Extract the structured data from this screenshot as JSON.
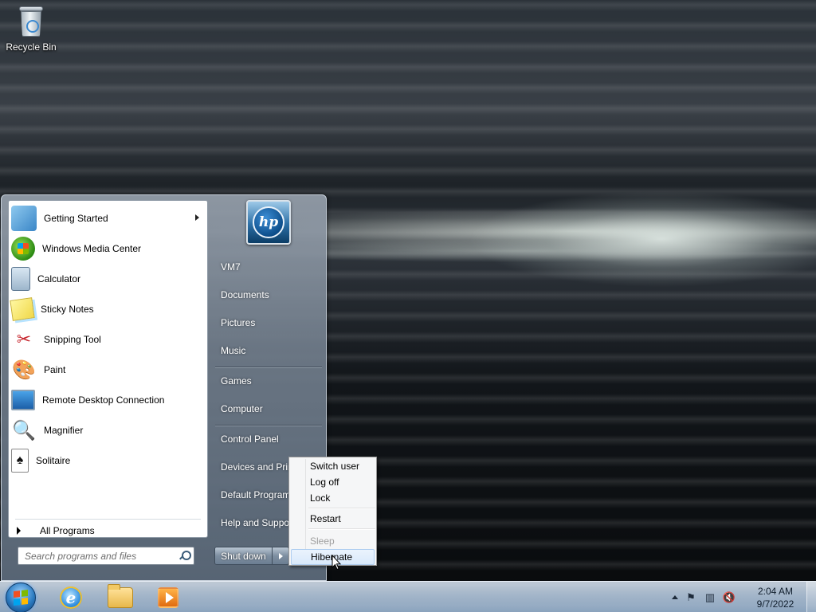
{
  "desktop": {
    "icons": [
      {
        "label": "Recycle Bin",
        "icon": "recycle-bin-icon"
      }
    ]
  },
  "start_menu": {
    "programs": [
      {
        "label": "Getting Started",
        "icon": "getting-started-icon",
        "has_submenu": true
      },
      {
        "label": "Windows Media Center",
        "icon": "windows-media-center-icon"
      },
      {
        "label": "Calculator",
        "icon": "calculator-icon"
      },
      {
        "label": "Sticky Notes",
        "icon": "sticky-notes-icon"
      },
      {
        "label": "Snipping Tool",
        "icon": "snipping-tool-icon"
      },
      {
        "label": "Paint",
        "icon": "paint-icon"
      },
      {
        "label": "Remote Desktop Connection",
        "icon": "remote-desktop-icon"
      },
      {
        "label": "Magnifier",
        "icon": "magnifier-icon"
      },
      {
        "label": "Solitaire",
        "icon": "solitaire-icon"
      }
    ],
    "all_programs_label": "All Programs",
    "search_placeholder": "Search programs and files",
    "user_picture_text": "hp",
    "right_items": [
      "VM7",
      "Documents",
      "Pictures",
      "Music",
      "Games",
      "Computer",
      "Control Panel",
      "Devices and Printers",
      "Default Programs",
      "Help and Support"
    ],
    "shutdown_label": "Shut down"
  },
  "shutdown_menu": {
    "items": [
      {
        "label": "Switch user",
        "enabled": true
      },
      {
        "label": "Log off",
        "enabled": true
      },
      {
        "label": "Lock",
        "enabled": true
      },
      {
        "label": "Restart",
        "enabled": true
      },
      {
        "label": "Sleep",
        "enabled": false
      },
      {
        "label": "Hibernate",
        "enabled": true,
        "highlighted": true
      }
    ]
  },
  "taskbar": {
    "pinned": [
      "internet-explorer-icon",
      "windows-explorer-icon",
      "windows-media-player-icon"
    ],
    "tray_icons": [
      "show-hidden-icons-icon",
      "action-center-flag-icon",
      "network-icon",
      "volume-muted-icon"
    ],
    "clock_time": "2:04 AM",
    "clock_date": "9/7/2022"
  }
}
